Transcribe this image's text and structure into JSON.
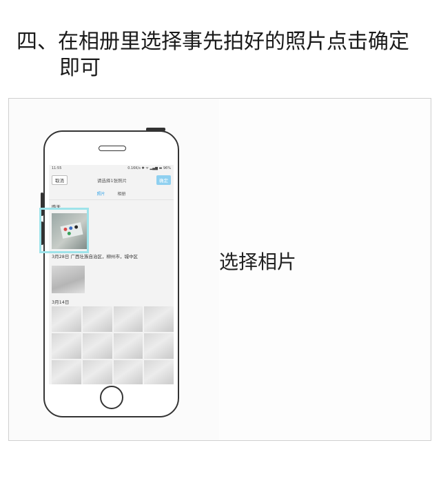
{
  "step": {
    "line1": "四、在相册里选择事先拍好的照片点击确定",
    "line2": "即可"
  },
  "caption": "选择相片",
  "phone": {
    "status_time": "11:55",
    "status_right": "0.16K/s ✱ ᯤ ▂▄▆ ▬ 96%",
    "cancel_label": "取消",
    "title": "请选择1张照片",
    "ok_label": "确定",
    "tab_photos": "照片",
    "tab_albums": "相册",
    "section_yesterday": "昨天",
    "location_line": "3月28日 广西壮族自治区，柳州市，城中区",
    "section_date2": "3月14日"
  },
  "colors": {
    "accent": "#3ba6e8",
    "ok_button": "#8fd0f0",
    "highlight": "#9ee3ea"
  }
}
